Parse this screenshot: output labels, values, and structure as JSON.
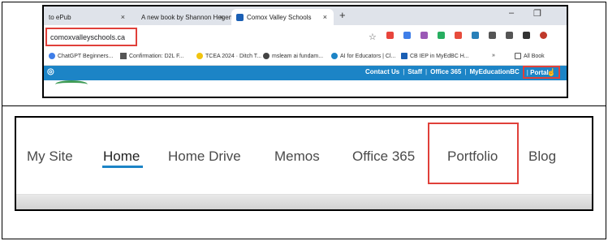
{
  "browser": {
    "tabs": [
      {
        "label": "to ePub",
        "close": "×"
      },
      {
        "label": "A new book by Shannon Hegen",
        "close": "×"
      },
      {
        "label": "Comox Valley Schools",
        "close": "×"
      }
    ],
    "new_tab": "+",
    "minimize": "–",
    "maximize": "❐",
    "address": "comoxvalleyschools.ca",
    "bookmarks": [
      {
        "label": "ChatGPT Beginners...",
        "color": "#3f7ee8"
      },
      {
        "label": "Confirmation: D2L F...",
        "color": "#555555"
      },
      {
        "label": "TCEA 2024 · Ditch T...",
        "color": "#222222"
      },
      {
        "label": "msleam ai fundam...",
        "color": "#444444"
      },
      {
        "label": "AI for Educators | Cl...",
        "color": "#1c84c6"
      },
      {
        "label": "CB IEP in MyEdBC H...",
        "color": "#1a5fb4"
      },
      {
        "label": "»",
        "color": ""
      },
      {
        "label": "All Book",
        "color": ""
      }
    ],
    "site_nav": {
      "links": [
        "Contact Us",
        "Staff",
        "Office 365",
        "MyEducationBC"
      ],
      "separator": "|",
      "portal": "Portal"
    }
  },
  "site": {
    "nav_items": [
      "My Site",
      "Home",
      "Home Drive",
      "Memos",
      "Office 365",
      "Portfolio",
      "Blog"
    ],
    "active": "Home",
    "highlighted": "Portfolio"
  },
  "colors": {
    "accent": "#1c84c6",
    "highlight": "#e0403a"
  }
}
